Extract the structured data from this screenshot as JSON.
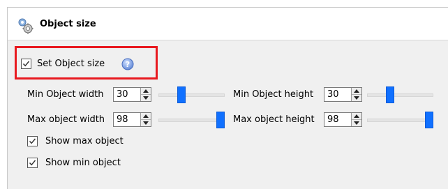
{
  "panel": {
    "title": "Object size",
    "icon": "gear-icon"
  },
  "set_size": {
    "label": "Set Object size",
    "checked": true,
    "help_icon": "help-icon"
  },
  "min_width": {
    "label": "Min Object width",
    "value": "30",
    "slider_fraction": 0.33
  },
  "max_width": {
    "label": "Max object width",
    "value": "98",
    "slider_fraction": 1.0
  },
  "min_height": {
    "label": "Min Object height",
    "value": "30",
    "slider_fraction": 0.33
  },
  "max_height": {
    "label": "Max object height",
    "value": "98",
    "slider_fraction": 1.0
  },
  "show_max": {
    "label": "Show max object",
    "checked": true
  },
  "show_min": {
    "label": "Show min object",
    "checked": true
  },
  "colors": {
    "highlight": "#e8191f",
    "slider_thumb": "#1070ff"
  }
}
